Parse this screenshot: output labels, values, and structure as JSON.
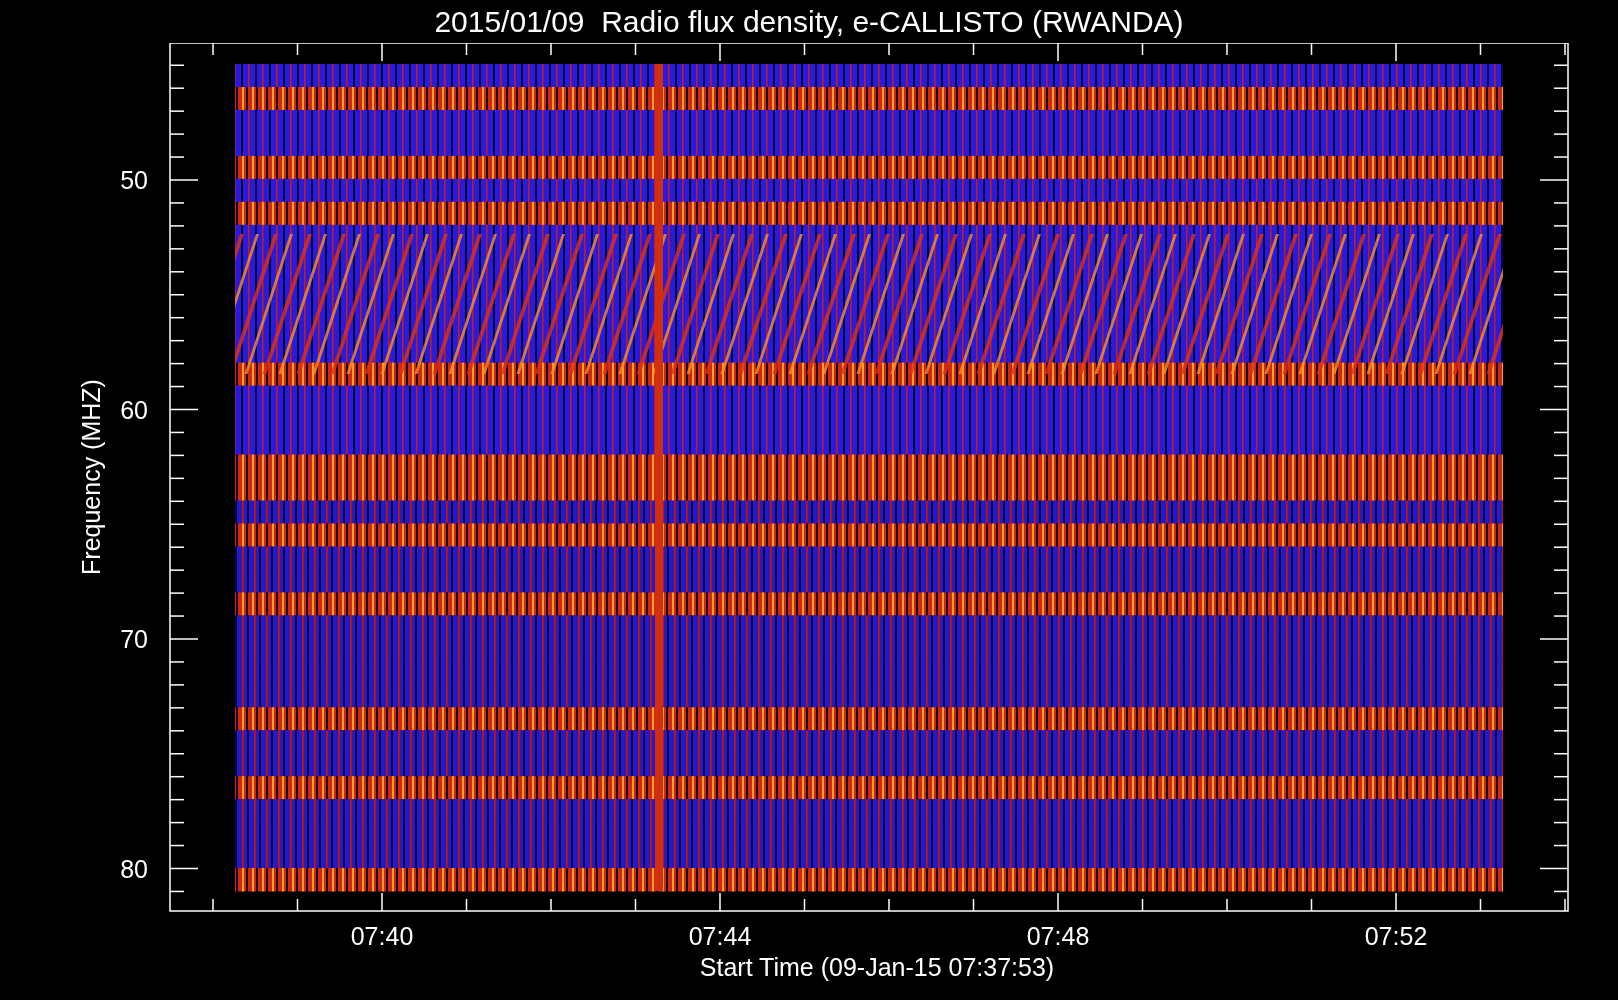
{
  "title": "2015/01/09  Radio flux density, e-CALLISTO (RWANDA)",
  "y_axis": {
    "label": "Frequency (MHZ)",
    "ticks": [
      "50",
      "60",
      "70",
      "80"
    ]
  },
  "x_axis": {
    "label": "Start Time (09-Jan-15 07:37:53)",
    "ticks": [
      "07:40",
      "07:44",
      "07:48",
      "07:52"
    ]
  }
}
